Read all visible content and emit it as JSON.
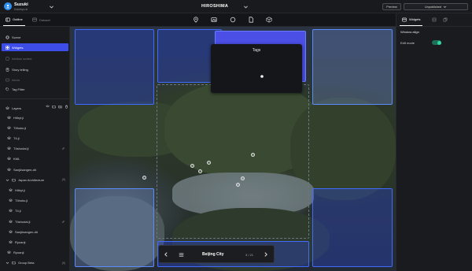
{
  "topbar": {
    "workspace_name": "Suzuki",
    "workspace_sub": "Kokekyo-ki",
    "project_title": "HIROSHIMA",
    "preview_label": "Preview",
    "publish_label": "Unpublished"
  },
  "toolbar": {
    "tabs": [
      {
        "label": "Outline",
        "icon": "outline-icon",
        "active": true
      },
      {
        "label": "Dataset",
        "icon": "dataset-icon",
        "active": false
      }
    ],
    "tools": [
      "map-pin-icon",
      "image-icon",
      "circle-icon",
      "file-icon",
      "cube-icon"
    ]
  },
  "left_panel": {
    "items": [
      {
        "label": "Scene",
        "icon": "globe-icon",
        "state": "normal"
      },
      {
        "label": "Widgets",
        "icon": "widgets-icon",
        "state": "selected"
      },
      {
        "label": "Infobox sorted",
        "icon": "infobox-icon",
        "state": "dim"
      },
      {
        "label": "Story telling",
        "icon": "story-icon",
        "state": "normal"
      },
      {
        "label": "Intros",
        "icon": "intro-icon",
        "state": "dim"
      },
      {
        "label": "Tag Filter",
        "icon": "tag-icon",
        "state": "normal"
      }
    ],
    "layers_label": "Layers",
    "layers": [
      {
        "label": "Hiltryt.ji",
        "indent": 1,
        "icon": "layer-icon",
        "extra": ""
      },
      {
        "label": "Tōhoku.ji",
        "indent": 1,
        "icon": "layer-icon",
        "extra": ""
      },
      {
        "label": "Tō.ji",
        "indent": 1,
        "icon": "layer-icon",
        "extra": ""
      },
      {
        "label": "Tōshodai.ji",
        "indent": 1,
        "icon": "layer-icon",
        "extra": "link"
      },
      {
        "label": "KML",
        "indent": 1,
        "icon": "layer-icon",
        "extra": ""
      },
      {
        "label": "Sanjūsangen-dō",
        "indent": 1,
        "icon": "layer-icon",
        "extra": ""
      },
      {
        "label": "Japan Architecture",
        "indent": 0,
        "icon": "folder-icon",
        "extra": "(9)"
      },
      {
        "label": "Hiltryt.ji",
        "indent": 2,
        "icon": "layer-icon",
        "extra": ""
      },
      {
        "label": "Tōhoku.ji",
        "indent": 2,
        "icon": "layer-icon",
        "extra": ""
      },
      {
        "label": "Tō.ji",
        "indent": 2,
        "icon": "layer-icon",
        "extra": ""
      },
      {
        "label": "Tōshodai.ji",
        "indent": 2,
        "icon": "layer-icon",
        "extra": "link"
      },
      {
        "label": "Sanjūsangen-dō",
        "indent": 2,
        "icon": "layer-icon",
        "extra": ""
      },
      {
        "label": "Ryoanji",
        "indent": 2,
        "icon": "layer-icon",
        "extra": ""
      },
      {
        "label": "Ryoanji",
        "indent": 1,
        "icon": "layer-icon",
        "extra": ""
      },
      {
        "label": "Group Beta",
        "indent": 0,
        "icon": "folder-icon",
        "extra": "(9)"
      }
    ]
  },
  "map": {
    "tags_widget_title": "Tags",
    "story_title": "Beijing City",
    "story_count": "3 / 21"
  },
  "right_panel": {
    "tabs": [
      {
        "label": "Widgets",
        "icon": "widgets-icon",
        "active": true
      },
      {
        "label": "",
        "icon": "extension-icon",
        "active": false
      },
      {
        "label": "",
        "icon": "copy-icon",
        "active": false
      }
    ],
    "section_title": "Window align",
    "edit_mode_label": "Edit mode",
    "edit_mode_on": true,
    "accent_color": "#2fd6a0"
  },
  "colors": {
    "selection": "#3d4ee8",
    "widget_zone": "#3f6cff"
  }
}
